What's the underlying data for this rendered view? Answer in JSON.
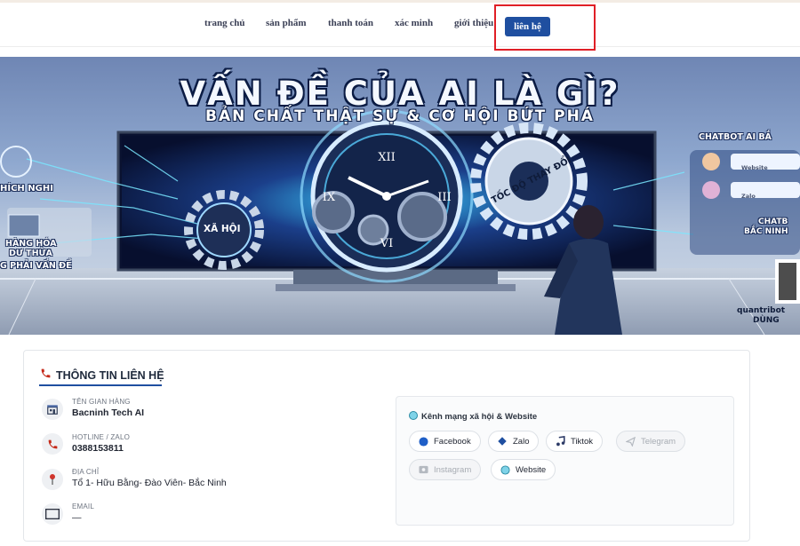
{
  "nav": {
    "items": [
      "trang chủ",
      "sản phẩm",
      "thanh toán",
      "xác minh",
      "giới thiệu"
    ],
    "active": "liên hệ"
  },
  "banner": {
    "title": "VẤN ĐỀ CỦA AI LÀ GÌ?",
    "subtitle": "BẢN CHẤT THẬT SỰ & CƠ HỘI BỨT PHÁ",
    "left_labels": [
      "HÍCH NGHI",
      "HÀNG HÓA",
      "DƯ THỪA",
      "G PHẢI VẤN ĐỀ"
    ],
    "center_labels": [
      "XÃ HỘI",
      "TỐC ĐỘ THAY ĐỔI"
    ],
    "right_title": "CHATBOT AI BẮ",
    "right_chat_labels": [
      "Website",
      "Zalo"
    ],
    "right_labels": [
      "CHATB",
      "BẮC NINH"
    ],
    "right_footer": [
      "quantribot",
      "DÙNG"
    ],
    "clock_numerals": [
      "XII",
      "III",
      "VI",
      "IX"
    ]
  },
  "contact": {
    "title": "THÔNG TIN LIÊN HỆ",
    "store_label": "TÊN GIAN HÀNG",
    "store_value": "Bacninh Tech AI",
    "hotline_label": "HOTLINE / ZALO",
    "hotline_value": "0388153811",
    "address_label": "ĐỊA CHỈ",
    "address_value": "Tổ 1- Hữu Bằng- Đào Viên- Bắc Ninh",
    "email_label": "EMAIL",
    "email_value": "—",
    "social_title": "Kênh mạng xã hội & Website",
    "social": [
      {
        "label": "Facebook",
        "icon": "facebook-icon",
        "active": true
      },
      {
        "label": "Zalo",
        "icon": "zalo-icon",
        "active": true
      },
      {
        "label": "Tiktok",
        "icon": "tiktok-icon",
        "active": true
      },
      {
        "label": "Telegram",
        "icon": "telegram-icon",
        "active": false
      },
      {
        "label": "Instagram",
        "icon": "instagram-icon",
        "active": false
      },
      {
        "label": "Website",
        "icon": "website-icon",
        "active": true
      }
    ]
  },
  "colors": {
    "accent": "#1f4fa0",
    "highlight": "#e01f26",
    "phone_icon": "#c52a1a"
  }
}
